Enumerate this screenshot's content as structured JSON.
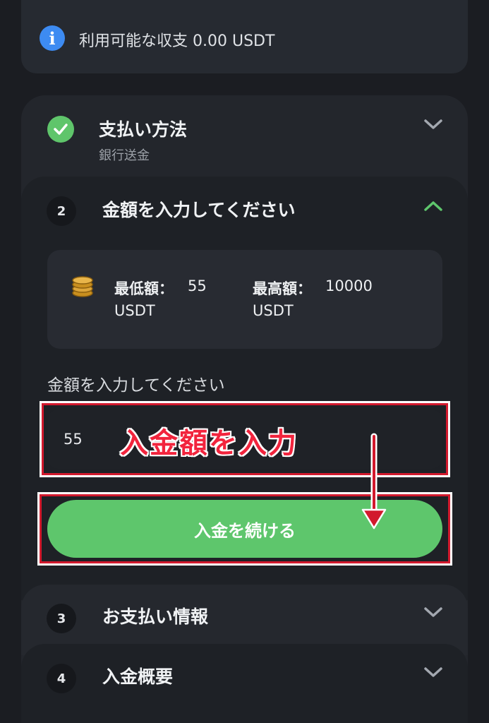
{
  "balance": {
    "text": "利用可能な収支 0.00 USDT",
    "icon": "info-icon"
  },
  "steps": [
    {
      "title": "支払い方法",
      "subtitle": "銀行送金",
      "state": "completed"
    },
    {
      "number": "2",
      "title": "金額を入力してください",
      "state": "expanded"
    },
    {
      "number": "3",
      "title": "お支払い情報",
      "state": "collapsed"
    },
    {
      "number": "4",
      "title": "入金概要",
      "state": "collapsed"
    }
  ],
  "limits": {
    "min_label": "最低額：",
    "min_value": "55",
    "max_label": "最高額：",
    "max_value": "10000",
    "unit": "USDT"
  },
  "amount": {
    "label": "金額を入力してください",
    "value": "55"
  },
  "continue_label": "入金を続ける",
  "annotation": "入金額を入力",
  "colors": {
    "accent_green": "#5ec66c",
    "info_blue": "#3d8bf2",
    "annotation_red": "#d2192d"
  }
}
